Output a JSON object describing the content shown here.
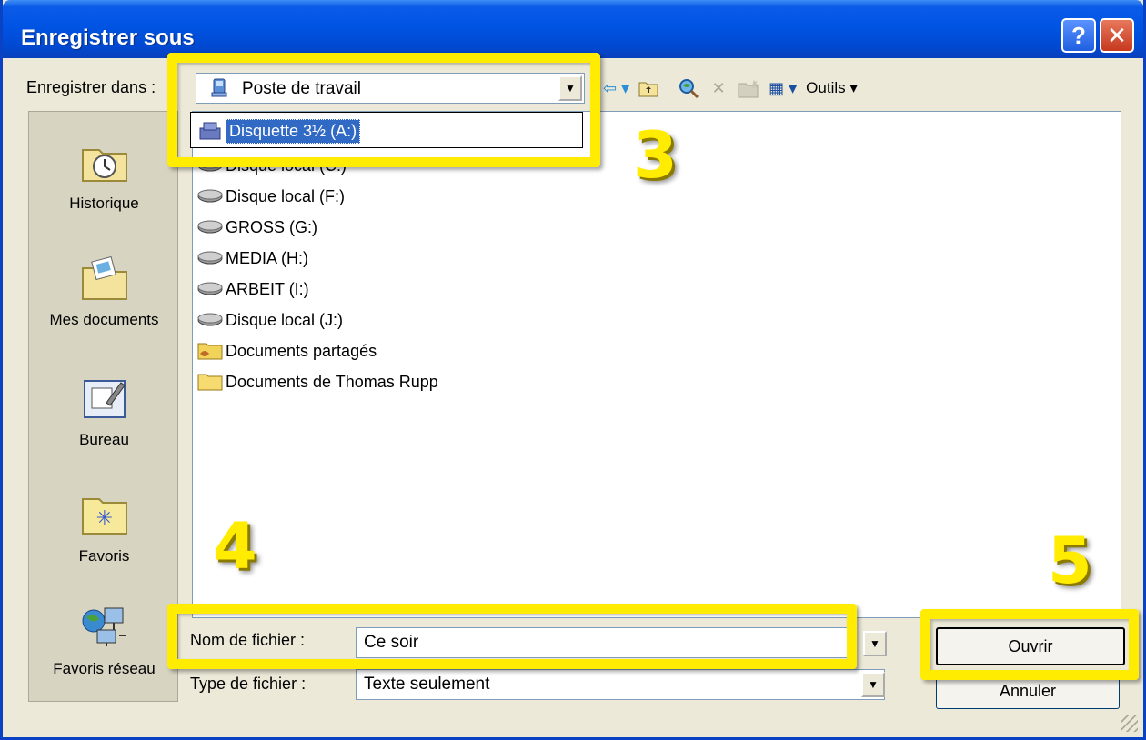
{
  "window": {
    "title": "Enregistrer sous",
    "help_glyph": "?",
    "close_glyph": "✕"
  },
  "lookin": {
    "label": "Enregistrer dans :",
    "value": "Poste de travail",
    "icon": "computer-icon"
  },
  "toolbar": {
    "back_glyph": "⇦ ▾",
    "up_glyph": "⤒",
    "search_icon": "search-web-icon",
    "delete_glyph": "✕",
    "new_folder_icon": "new-folder-icon",
    "views_glyph": "▦ ▾",
    "tools_label": "Outils ▾"
  },
  "places": [
    {
      "label": "Historique",
      "icon": "history-icon"
    },
    {
      "label": "Mes documents",
      "icon": "my-documents-icon"
    },
    {
      "label": "Bureau",
      "icon": "desktop-icon"
    },
    {
      "label": "Favoris",
      "icon": "favorites-icon"
    },
    {
      "label": "Favoris réseau",
      "icon": "network-icon"
    }
  ],
  "dropdown": {
    "selected_item": "Disquette 3½ (A:)",
    "icon": "floppy-icon"
  },
  "files": [
    {
      "name": "Disque local (C:)",
      "icon": "drive-icon"
    },
    {
      "name": "Disque local (F:)",
      "icon": "drive-icon"
    },
    {
      "name": "GROSS (G:)",
      "icon": "drive-icon"
    },
    {
      "name": "MEDIA (H:)",
      "icon": "drive-icon"
    },
    {
      "name": "ARBEIT (I:)",
      "icon": "drive-icon"
    },
    {
      "name": "Disque local (J:)",
      "icon": "drive-icon"
    },
    {
      "name": "Documents partagés",
      "icon": "shared-folder-icon"
    },
    {
      "name": "Documents de Thomas Rupp",
      "icon": "folder-icon"
    }
  ],
  "filename": {
    "label": "Nom de fichier :",
    "value": "Ce soir"
  },
  "filetype": {
    "label": "Type de fichier :",
    "value": "Texte seulement"
  },
  "buttons": {
    "open": "Ouvrir",
    "cancel": "Annuler"
  },
  "annotations": {
    "step3": "3",
    "step4": "4",
    "step5": "5",
    "color": "#ffec00"
  }
}
